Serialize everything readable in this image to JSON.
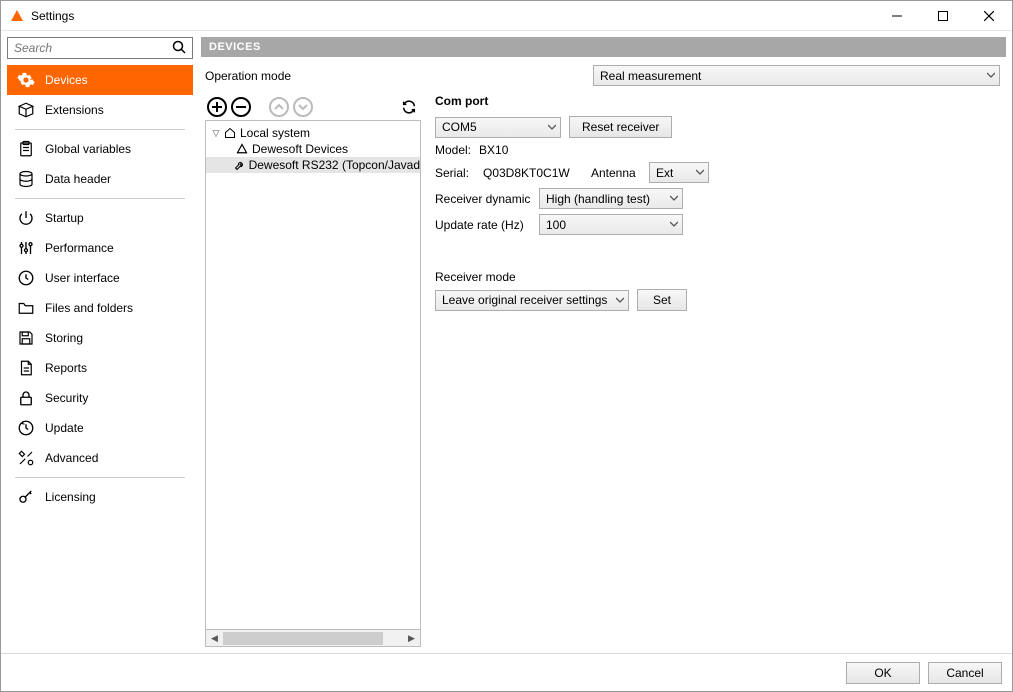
{
  "window": {
    "title": "Settings"
  },
  "search": {
    "placeholder": "Search"
  },
  "sidebar": {
    "items": [
      {
        "label": "Devices"
      },
      {
        "label": "Extensions"
      },
      {
        "label": "Global variables"
      },
      {
        "label": "Data header"
      },
      {
        "label": "Startup"
      },
      {
        "label": "Performance"
      },
      {
        "label": "User interface"
      },
      {
        "label": "Files and folders"
      },
      {
        "label": "Storing"
      },
      {
        "label": "Reports"
      },
      {
        "label": "Security"
      },
      {
        "label": "Update"
      },
      {
        "label": "Advanced"
      },
      {
        "label": "Licensing"
      }
    ]
  },
  "section": {
    "header": "DEVICES"
  },
  "operation": {
    "label": "Operation mode",
    "value": "Real measurement"
  },
  "tree": {
    "root": "Local system",
    "child1": "Dewesoft Devices",
    "child2": "Dewesoft RS232 (Topcon/Javad"
  },
  "detail": {
    "header": "Com port",
    "port": "COM5",
    "reset_label": "Reset receiver",
    "model_label": "Model:",
    "model_value": "BX10",
    "serial_label": "Serial:",
    "serial_value": "Q03D8KT0C1W",
    "antenna_label": "Antenna",
    "antenna_value": "Ext",
    "dyn_label": "Receiver dynamic",
    "dyn_value": "High (handling test)",
    "rate_label": "Update rate (Hz)",
    "rate_value": "100",
    "mode_label": "Receiver mode",
    "mode_value": "Leave original receiver settings",
    "set_label": "Set"
  },
  "footer": {
    "ok": "OK",
    "cancel": "Cancel"
  }
}
